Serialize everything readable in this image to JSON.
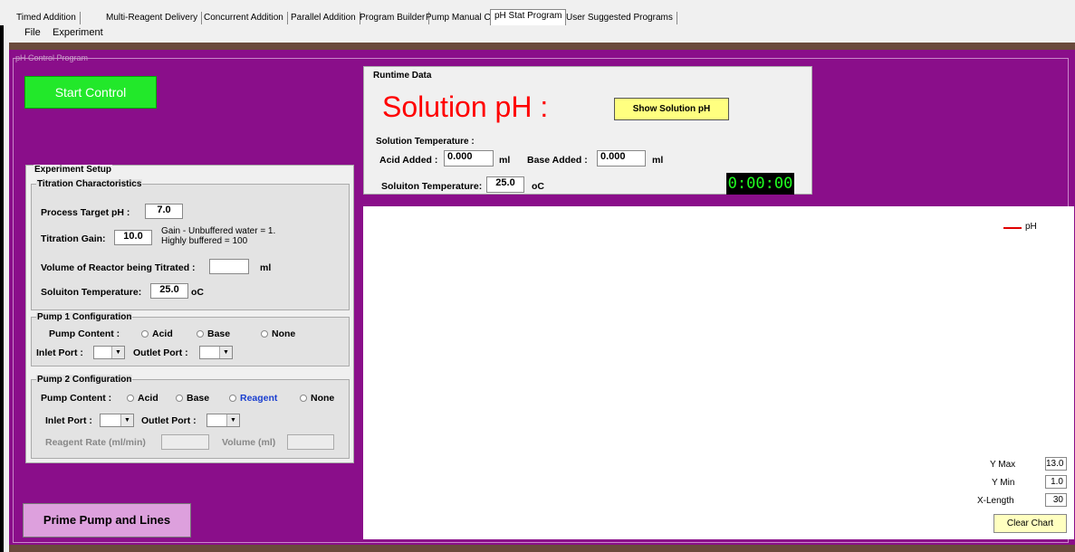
{
  "tabs": [
    "Timed Addition",
    "Multi-Reagent Delivery",
    "Concurrent Addition",
    "Parallel Addition",
    "Program Builder",
    "Pump Manual Control",
    "pH Stat Program",
    "User Suggested Programs"
  ],
  "active_tab": "pH Stat Program",
  "menu": {
    "file": "File",
    "experiment": "Experiment"
  },
  "ph_control": {
    "group_title": "pH Control Program",
    "start_button": "Start Control",
    "prime_button": "Prime Pump and Lines"
  },
  "experiment_setup": {
    "title": "Experiment Setup",
    "titration": {
      "title": "Titration Charactoristics",
      "target_ph_label": "Process Target pH :",
      "target_ph_value": "7.0",
      "gain_label": "Titration Gain:",
      "gain_value": "10.0",
      "gain_hint_1": "Gain - Unbuffered water = 1.",
      "gain_hint_2": "Highly buffered = 100",
      "volume_label": "Volume of Reactor being Titrated :",
      "volume_value": "",
      "volume_unit": "ml",
      "temp_label": "Soluiton Temperature:",
      "temp_value": "25.0",
      "temp_unit": "oC"
    },
    "pump1": {
      "title": "Pump 1 Configuration",
      "content_label": "Pump Content :",
      "opt_acid": "Acid",
      "opt_base": "Base",
      "opt_none": "None",
      "inlet_label": "Inlet Port :",
      "outlet_label": "Outlet Port :"
    },
    "pump2": {
      "title": "Pump 2 Configuration",
      "content_label": "Pump Content :",
      "opt_acid": "Acid",
      "opt_base": "Base",
      "opt_reagent": "Reagent",
      "opt_none": "None",
      "inlet_label": "Inlet Port :",
      "outlet_label": "Outlet Port :",
      "rate_label": "Reagent Rate (ml/min)",
      "volume_label": "Volume (ml)"
    }
  },
  "runtime": {
    "title": "Runtime Data",
    "solution_ph_label": "Solution pH :",
    "show_ph_button": "Show Solution pH",
    "solution_temp_label": "Solution Temperature :",
    "acid_label": "Acid Added :",
    "acid_value": "0.000",
    "acid_unit": "ml",
    "base_label": "Base Added :",
    "base_value": "0.000",
    "base_unit": "ml",
    "temp_label": "Soluiton Temperature:",
    "temp_value": "25.0",
    "temp_unit": "oC",
    "timer": "0:00:00"
  },
  "chart": {
    "legend": "pH",
    "ymax_label": "Y Max",
    "ymax_value": "13.0",
    "ymin_label": "Y Min",
    "ymin_value": "1.0",
    "xlen_label": "X-Length",
    "xlen_value": "30",
    "clear_button": "Clear Chart"
  },
  "colors": {
    "purple": "#8a0e8a",
    "start_green": "#22e82a",
    "ph_red": "#ff0000",
    "series": "#e00000"
  }
}
